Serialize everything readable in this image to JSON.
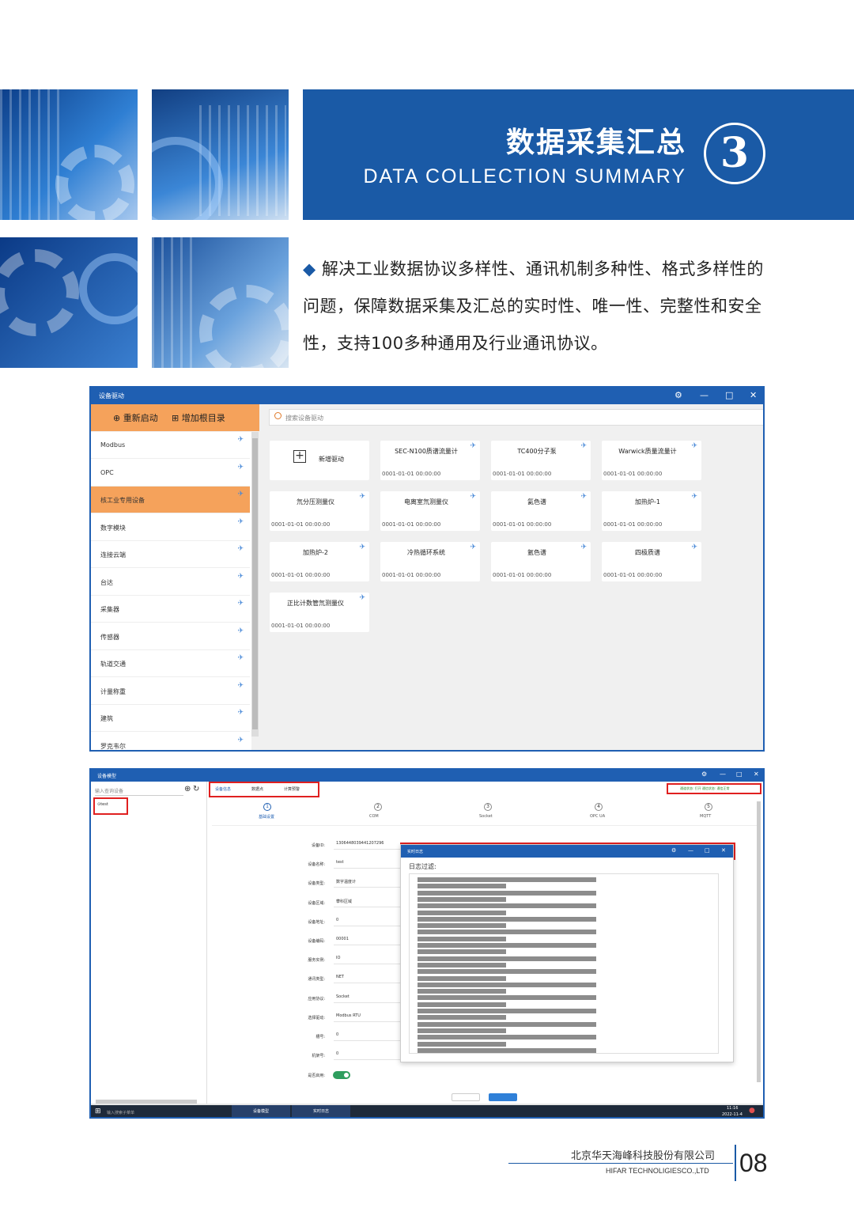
{
  "banner": {
    "title_cn": "数据采集汇总",
    "title_en": "DATA COLLECTION SUMMARY",
    "number": "3"
  },
  "intro": {
    "bullet": "◆",
    "text": "解决工业数据协议多样性、通讯机制多种性、格式多样性的问题，保障数据采集及汇总的实时性、唯一性、完整性和安全性，支持100多种通用及行业通讯协议。"
  },
  "window1": {
    "title": "设备驱动",
    "restart_label": "重新启动",
    "add_root_label": "增加根目录",
    "search_placeholder": "搜索设备驱动",
    "sidebar": [
      "Modbus",
      "OPC",
      "核工业专用设备",
      "数字模块",
      "连接云端",
      "台达",
      "采集器",
      "传感器",
      "轨道交通",
      "计量称重",
      "建筑",
      "罗克韦尔"
    ],
    "selected_index": 2,
    "new_driver_label": "新增驱动",
    "cards": [
      {
        "name": "SEC-N100质谱流量计",
        "date": "0001-01-01 00:00:00"
      },
      {
        "name": "TC400分子泵",
        "date": "0001-01-01 00:00:00"
      },
      {
        "name": "Warwick质量流量计",
        "date": "0001-01-01 00:00:00"
      },
      {
        "name": "氘分压测量仪",
        "date": "0001-01-01 00:00:00"
      },
      {
        "name": "电离室氘测量仪",
        "date": "0001-01-01 00:00:00"
      },
      {
        "name": "氦色谱",
        "date": "0001-01-01 00:00:00"
      },
      {
        "name": "加热炉-1",
        "date": "0001-01-01 00:00:00"
      },
      {
        "name": "加热炉-2",
        "date": "0001-01-01 00:00:00"
      },
      {
        "name": "冷热循环系统",
        "date": "0001-01-01 00:00:00"
      },
      {
        "name": "氩色谱",
        "date": "0001-01-01 00:00:00"
      },
      {
        "name": "四极质谱",
        "date": "0001-01-01 00:00:00"
      },
      {
        "name": "正比计数管氘测量仪",
        "date": "0001-01-01 00:00:00"
      }
    ]
  },
  "window2": {
    "title": "设备模型",
    "search_placeholder": "输入查询设备",
    "tree_item": "⊙test",
    "tabs": [
      "设备信息",
      "数据点",
      "计算预警"
    ],
    "status_text": "通道状态: 打开 通信状态: 通信正常",
    "steps": [
      {
        "n": "1",
        "label": "基础设置"
      },
      {
        "n": "2",
        "label": "COM"
      },
      {
        "n": "3",
        "label": "Socket"
      },
      {
        "n": "4",
        "label": "OPC UA"
      },
      {
        "n": "5",
        "label": "MQTT"
      }
    ],
    "fields": [
      {
        "label": "设备ID:",
        "value": "1306448039441207296"
      },
      {
        "label": "设备名称:",
        "value": "test"
      },
      {
        "label": "设备类型:",
        "value": "数字温度计"
      },
      {
        "label": "设备区域:",
        "value": "攀科区域"
      },
      {
        "label": "设备地址:",
        "value": "0"
      },
      {
        "label": "设备编码:",
        "value": "00001"
      },
      {
        "label": "服务实例:",
        "value": "IO"
      },
      {
        "label": "通讯类型:",
        "value": "NET"
      },
      {
        "label": "应用协议:",
        "value": "Socket"
      },
      {
        "label": "选择驱动:",
        "value": "Modbus RTU"
      },
      {
        "label": "槽号:",
        "value": "0"
      },
      {
        "label": "机架号:",
        "value": "0"
      }
    ],
    "enabled_label": "是否启用:",
    "log_title": "实时日志",
    "log_filter_label": "日志过滤:",
    "bottom_search": "输入搜索子菜单",
    "task_tab1": "设备模型",
    "task_tab2": "实时日志",
    "clock_time": "11:16",
    "clock_date": "2022-11-4"
  },
  "footer": {
    "company_cn": "北京华天海峰科技股份有限公司",
    "company_en": "HIFAR TECHNOLIGIESCO.,LTD",
    "page": "08"
  }
}
